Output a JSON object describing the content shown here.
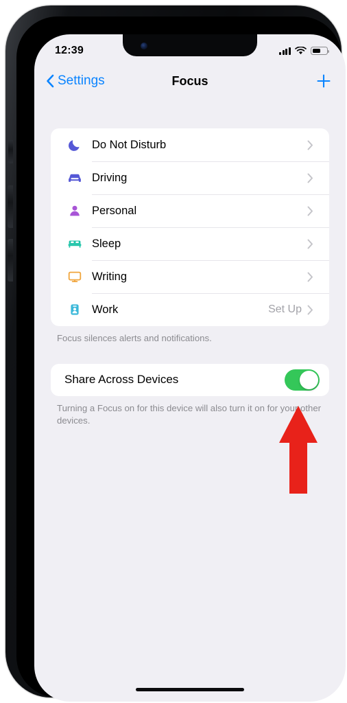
{
  "status_bar": {
    "time": "12:39",
    "signal_icon": "cellular-signal-icon",
    "wifi_icon": "wifi-icon",
    "battery_icon": "battery-icon",
    "battery_level_percent": 52
  },
  "nav": {
    "back_label": "Settings",
    "back_icon": "chevron-left-icon",
    "title": "Focus",
    "add_icon": "plus-icon"
  },
  "focus_list": {
    "items": [
      {
        "label": "Do Not Disturb",
        "icon": "moon-icon",
        "color": "#5558d6",
        "value": "",
        "chevron": "chevron-right-icon"
      },
      {
        "label": "Driving",
        "icon": "car-icon",
        "color": "#5558d6",
        "value": "",
        "chevron": "chevron-right-icon"
      },
      {
        "label": "Personal",
        "icon": "person-icon",
        "color": "#a855d6",
        "value": "",
        "chevron": "chevron-right-icon"
      },
      {
        "label": "Sleep",
        "icon": "bed-icon",
        "color": "#1fc4a8",
        "value": "",
        "chevron": "chevron-right-icon"
      },
      {
        "label": "Writing",
        "icon": "monitor-icon",
        "color": "#f0a53c",
        "value": "",
        "chevron": "chevron-right-icon"
      },
      {
        "label": "Work",
        "icon": "id-badge-icon",
        "color": "#3bb8d9",
        "value": "Set Up",
        "chevron": "chevron-right-icon"
      }
    ],
    "footnote": "Focus silences alerts and notifications."
  },
  "share_section": {
    "label": "Share Across Devices",
    "toggle_on": true,
    "toggle_color": "#34c759",
    "footnote": "Turning a Focus on for this device will also turn it on for your other devices."
  },
  "annotation": {
    "arrow_icon": "up-arrow-annotation",
    "color": "#e8221a"
  },
  "home_indicator": "home-indicator"
}
